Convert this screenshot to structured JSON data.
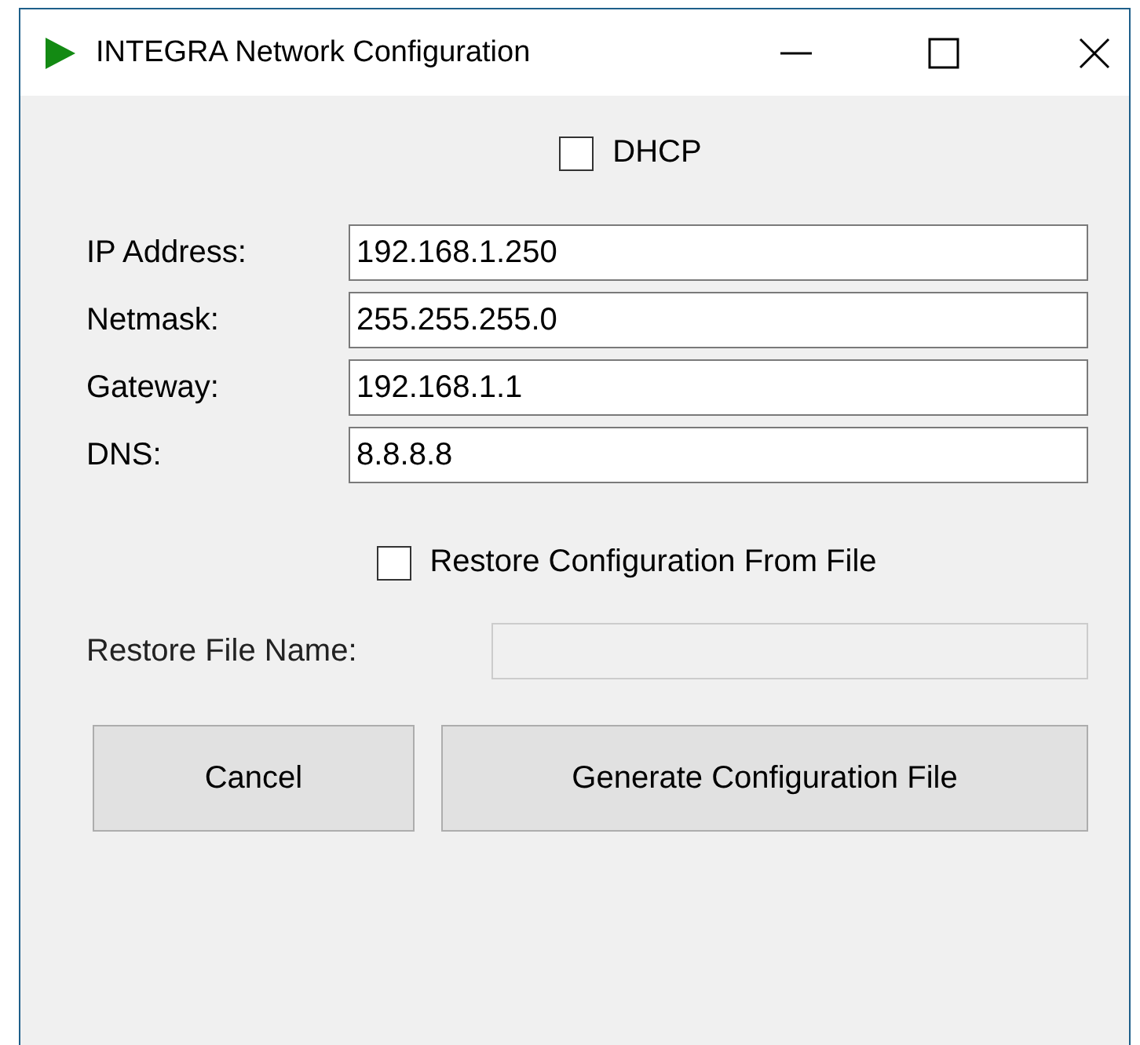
{
  "window": {
    "title": "INTEGRA Network Configuration"
  },
  "dhcp": {
    "label": "DHCP",
    "checked": false
  },
  "fields": [
    {
      "label": "IP Address:",
      "value": "192.168.1.250"
    },
    {
      "label": "Netmask:",
      "value": "255.255.255.0"
    },
    {
      "label": "Gateway:",
      "value": "192.168.1.1"
    },
    {
      "label": "DNS:",
      "value": "8.8.8.8"
    }
  ],
  "restore": {
    "label": "Restore Configuration From File",
    "checked": false
  },
  "restore_file": {
    "label": "Restore File Name:",
    "disabled": true
  },
  "buttons": [
    "Cancel",
    "Generate Configuration File"
  ]
}
